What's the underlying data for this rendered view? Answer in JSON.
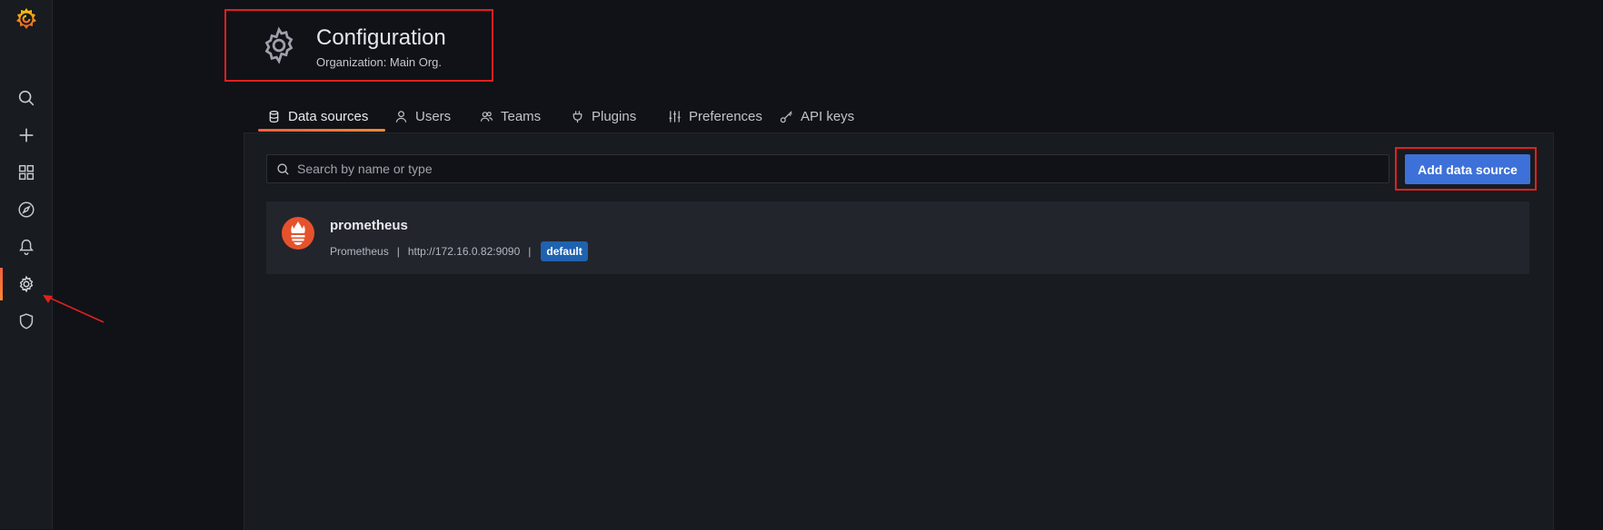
{
  "sidebar": {
    "items": [
      {
        "icon": "search-icon"
      },
      {
        "icon": "plus-icon"
      },
      {
        "icon": "dashboards-icon"
      },
      {
        "icon": "compass-icon"
      },
      {
        "icon": "bell-icon"
      },
      {
        "icon": "gear-icon",
        "active": true
      },
      {
        "icon": "shield-icon"
      }
    ]
  },
  "header": {
    "title": "Configuration",
    "subtitle": "Organization: Main Org."
  },
  "tabs": [
    {
      "label": "Data sources",
      "icon": "database-icon",
      "active": true
    },
    {
      "label": "Users",
      "icon": "user-icon"
    },
    {
      "label": "Teams",
      "icon": "users-icon"
    },
    {
      "label": "Plugins",
      "icon": "plug-icon"
    },
    {
      "label": "Preferences",
      "icon": "sliders-icon"
    },
    {
      "label": "API keys",
      "icon": "key-icon"
    }
  ],
  "search": {
    "placeholder": "Search by name or type",
    "value": ""
  },
  "actions": {
    "add_label": "Add data source"
  },
  "datasources": [
    {
      "name": "prometheus",
      "type": "Prometheus",
      "url": "http://172.16.0.82:9090",
      "badge": "default",
      "logo": "prometheus-logo"
    }
  ],
  "colors": {
    "accent": "#ff8833",
    "primary_button": "#3d71d9",
    "badge": "#1f62b0",
    "annotation": "#e02020",
    "background": "#111217",
    "panel": "#181b1f"
  }
}
